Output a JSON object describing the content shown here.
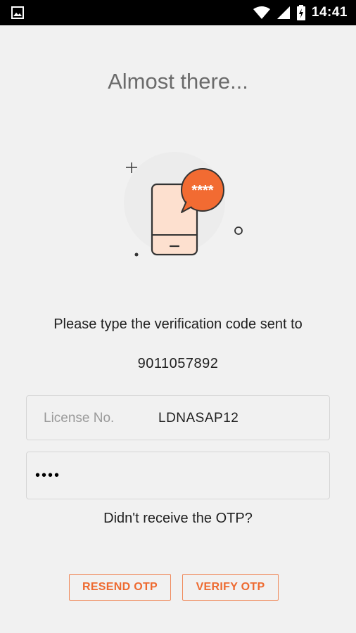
{
  "status_bar": {
    "time": "14:41",
    "icons": [
      "image-notification-icon",
      "wifi-icon",
      "cell-signal-icon",
      "battery-charging-icon"
    ]
  },
  "screen": {
    "title": "Almost there...",
    "instruction": "Please type the verification code sent to",
    "phone_number": "9011057892"
  },
  "license_field": {
    "label": "License No.",
    "value": "LDNASAP12"
  },
  "otp_field": {
    "value": "••••"
  },
  "illustration": {
    "icon": "phone-otp-message-icon",
    "bubble_text": "****"
  },
  "no_otp_text": "Didn't receive the OTP?",
  "buttons": {
    "resend": "RESEND OTP",
    "verify": "VERIFY OTP"
  },
  "colors": {
    "accent": "#ee6a30",
    "background": "#f1f1f1",
    "status_bar": "#000000"
  }
}
